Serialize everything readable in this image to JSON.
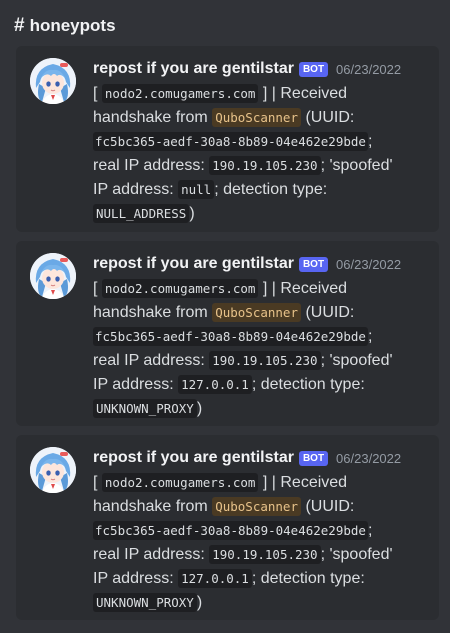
{
  "channel": {
    "hash": "#",
    "name": "honeypots"
  },
  "messages": [
    {
      "username": "repost if you are gentilstar",
      "bot_tag": "BOT",
      "timestamp": "06/23/2022",
      "open_bracket": "[",
      "server": "nodo2.comugamers.com",
      "close_bracket_sep": "] | Received",
      "handshake_from": "handshake from",
      "scanner": "QuboScanner",
      "uuid_label": "(UUID:",
      "uuid": "fc5bc365-aedf-30a8-8b89-04e462e29bde",
      "uuid_sep": ";",
      "real_ip_label": "real IP address:",
      "real_ip": "190.19.105.230",
      "spoofed_label": "; 'spoofed'",
      "ip_label": "IP address:",
      "ip": "null",
      "detection_label": "; detection type:",
      "detection_type": "NULL_ADDRESS",
      "close_paren": ")"
    },
    {
      "username": "repost if you are gentilstar",
      "bot_tag": "BOT",
      "timestamp": "06/23/2022",
      "open_bracket": "[",
      "server": "nodo2.comugamers.com",
      "close_bracket_sep": "] | Received",
      "handshake_from": "handshake from",
      "scanner": "QuboScanner",
      "uuid_label": "(UUID:",
      "uuid": "fc5bc365-aedf-30a8-8b89-04e462e29bde",
      "uuid_sep": ";",
      "real_ip_label": "real IP address:",
      "real_ip": "190.19.105.230",
      "spoofed_label": "; 'spoofed'",
      "ip_label": "IP address:",
      "ip": "127.0.0.1",
      "detection_label": "; detection type:",
      "detection_type": "UNKNOWN_PROXY",
      "close_paren": ")"
    },
    {
      "username": "repost if you are gentilstar",
      "bot_tag": "BOT",
      "timestamp": "06/23/2022",
      "open_bracket": "[",
      "server": "nodo2.comugamers.com",
      "close_bracket_sep": "] | Received",
      "handshake_from": "handshake from",
      "scanner": "QuboScanner",
      "uuid_label": "(UUID:",
      "uuid": "fc5bc365-aedf-30a8-8b89-04e462e29bde",
      "uuid_sep": ";",
      "real_ip_label": "real IP address:",
      "real_ip": "190.19.105.230",
      "spoofed_label": "; 'spoofed'",
      "ip_label": "IP address:",
      "ip": "127.0.0.1",
      "detection_label": "; detection type:",
      "detection_type": "UNKNOWN_PROXY",
      "close_paren": ")"
    }
  ],
  "colors": {
    "background": "#313338",
    "card": "#2b2d31",
    "bot_tag": "#5865f2",
    "code_bg": "#1e1f22",
    "highlight_bg": "#4a3a23",
    "timestamp": "#949ba4"
  },
  "icons": {
    "avatar": "anime-avatar-icon",
    "channel": "hash-icon"
  }
}
